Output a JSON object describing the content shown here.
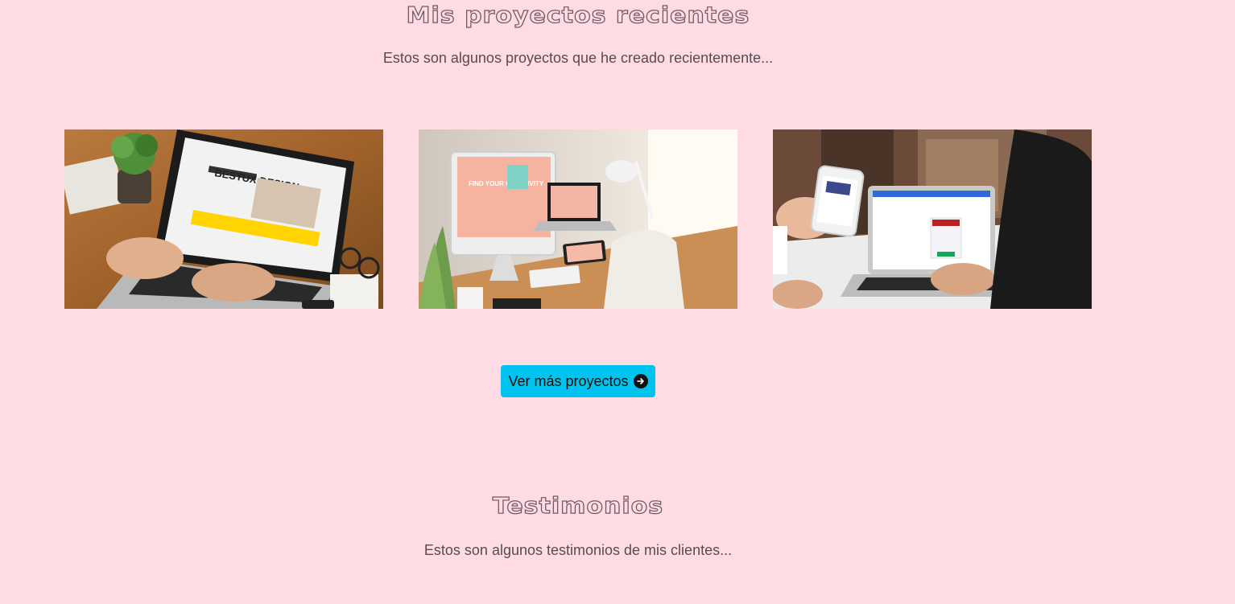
{
  "projects": {
    "title": "Mis proyectos recientes",
    "subtitle": "Estos son algunos proyectos que he creado recientemente...",
    "images": [
      {
        "name": "laptop-web-design-photo",
        "screen_text": "BESTUX DESIGN"
      },
      {
        "name": "responsive-desk-devices-photo",
        "screen_text": "FIND YOUR CREATIVITY"
      },
      {
        "name": "phone-and-laptop-photo"
      }
    ],
    "more_button_label": "Ver más proyectos",
    "more_button_icon": "arrow-right-circle-icon"
  },
  "testimonials": {
    "title": "Testimonios",
    "subtitle": "Estos son algunos testimonios de mis clientes..."
  },
  "colors": {
    "background": "#ffdce3",
    "button": "#00c4ef",
    "text": "#5a4a52"
  }
}
